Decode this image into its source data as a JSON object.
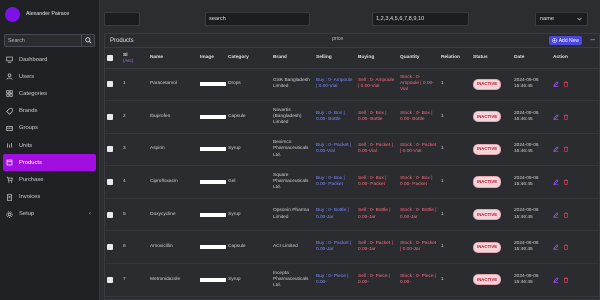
{
  "user": {
    "name": "Alexander Pairace"
  },
  "sidebar": {
    "search_placeholder": "Search",
    "items": [
      {
        "label": "Dashboard",
        "icon": "monitor-icon"
      },
      {
        "label": "Users",
        "icon": "users-icon"
      },
      {
        "label": "Categories",
        "icon": "categories-icon"
      },
      {
        "label": "Brands",
        "icon": "brands-icon"
      },
      {
        "label": "Groups",
        "icon": "groups-icon"
      },
      {
        "label": "Units",
        "icon": "units-icon"
      },
      {
        "label": "Products",
        "icon": "products-icon",
        "active": true
      },
      {
        "label": "Purchase",
        "icon": "cart-icon"
      },
      {
        "label": "Invoices",
        "icon": "invoice-icon"
      },
      {
        "label": "Setup",
        "icon": "gear-icon",
        "caret": "‹"
      }
    ]
  },
  "filters": {
    "first": "",
    "search": "search",
    "ids": "1,2,3,4,5,6,7,8,9,10",
    "sort": "name"
  },
  "panel": {
    "title": "Products",
    "price_label": "price",
    "add_label": "Add New",
    "collapse": "–"
  },
  "table": {
    "headers": {
      "sl": "Sl",
      "sl_sub": "(Asc)",
      "name": "Name",
      "image": "Image",
      "category": "Category",
      "brand": "Brand",
      "selling": "Selling",
      "buying": "Buying",
      "quantity": "Quantity",
      "relation": "Relation",
      "status": "Status",
      "date": "Date",
      "action": "Action"
    },
    "rows": [
      {
        "sl": "1",
        "name": "Paracetamol",
        "category": "Drops",
        "brand": "GSK Bangladesh Limited",
        "selling": "Buy : 0- Ampoule | 0.00-Vial",
        "buying": "Sell : 0- Ampoule | 0.00-Vial",
        "quantity": "Stock : 0- Ampoule | 0.00-Vial",
        "relation": "1",
        "status": "INACTIVE",
        "date": "2024-09-06 15:46:45"
      },
      {
        "sl": "2",
        "name": "Ibuprofen",
        "category": "Capsule",
        "brand": "Novartis (Bangladesh) Limited",
        "selling": "Buy : 0- Box | 0.00- Bottle",
        "buying": "Sell : 0- Box | 0.00- Bottle",
        "quantity": "Stock : 0- Box | 0.00- Bottle",
        "relation": "1",
        "status": "INACTIVE",
        "date": "2024-09-06 15:46:45"
      },
      {
        "sl": "3",
        "name": "Aspirin",
        "category": "Syrup",
        "brand": "Beximco Pharmaceuticals Ltd.",
        "selling": "Buy : 0- Packet | 0.00-Vial",
        "buying": "Sell : 0- Packet | 0.00-Vial",
        "quantity": "Stock : 0- Packet | 0.00-Vial",
        "relation": "1",
        "status": "INACTIVE",
        "date": "2024-09-06 15:46:45"
      },
      {
        "sl": "4",
        "name": "Ciprofloxacin",
        "category": "Gel",
        "brand": "Square Pharmaceuticals Ltd.",
        "selling": "Buy : 0- Box | 0.00- Packet",
        "buying": "Sell : 0- Box | 0.00- Packet",
        "quantity": "Stock : 0- Box | 0.00- Packet",
        "relation": "1",
        "status": "INACTIVE",
        "date": "2024-09-06 15:46:45"
      },
      {
        "sl": "5",
        "name": "Doxycycline",
        "category": "Syrup",
        "brand": "Opsonin Pharma Limited",
        "selling": "Buy : 0- Bottle | 0.00-Jar",
        "buying": "Sell : 0- Bottle | 0.00-Jar",
        "quantity": "Stock : 0- Bottle | 0.00-Jar",
        "relation": "1",
        "status": "INACTIVE",
        "date": "2024-09-06 15:46:45"
      },
      {
        "sl": "6",
        "name": "Amoxicillin",
        "category": "Capsule",
        "brand": "ACI Limited",
        "selling": "Buy : 0- Packet | 0.00-Jar",
        "buying": "Sell : 0- Packet | 0.00-Jar",
        "quantity": "Stock : 0- Packet | 0.00-Jar",
        "relation": "1",
        "status": "INACTIVE",
        "date": "2024-09-06 15:46:45"
      },
      {
        "sl": "7",
        "name": "Metronidazole",
        "category": "Syrup",
        "brand": "Incepta Pharmaceuticals Ltd.",
        "selling": "Buy : 0- Piece | 0.00-",
        "buying": "Sell : 0- Piece | 0.00-",
        "quantity": "Stock : 0- Piece | 0.00-",
        "relation": "1",
        "status": "INACTIVE",
        "date": "2024-09-06 15:46:45"
      }
    ]
  },
  "colors": {
    "accent": "#a10fe0",
    "add_button": "#4b48e0",
    "inactive": "#c2182f"
  }
}
